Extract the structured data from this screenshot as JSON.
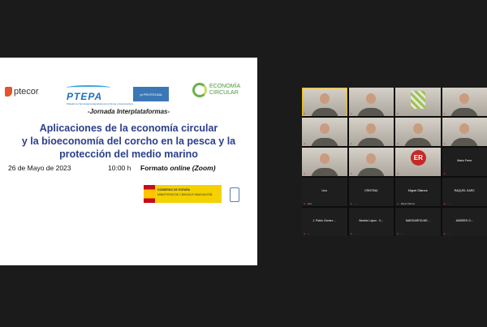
{
  "slide": {
    "logos": {
      "ptecor": "ptecor",
      "ptepa": "PTEPA",
      "ptepa_sub": "Plataforma Tecnológica Española de la Pesca y la Acuicultura",
      "protecma": "pt PROTECMA",
      "ec_line1": "ECONOMÍA",
      "ec_line2": "CIRCULAR"
    },
    "event_label": "-Jornada Interplataformas-",
    "title_lines": [
      "Aplicaciones de la economía circular",
      "y la bioeconomía del corcho en la pesca y la",
      "protección del medio marino"
    ],
    "date": "26 de Mayo de 2023",
    "time": "10:00 h",
    "format_prefix": "Formato ",
    "format_mode": "online (Zoom)",
    "gov_line1": "GOBIERNO DE ESPAÑA",
    "gov_line2": "MINISTERIO DE CIENCIA E INNOVACIÓN"
  },
  "gallery": {
    "tiles": [
      {
        "kind": "video",
        "speaking": true,
        "label": ""
      },
      {
        "kind": "video",
        "label": "..."
      },
      {
        "kind": "pattern",
        "label": "..."
      },
      {
        "kind": "video",
        "label": "..."
      },
      {
        "kind": "video",
        "label": "..."
      },
      {
        "kind": "video",
        "label": "..."
      },
      {
        "kind": "video",
        "label": "..."
      },
      {
        "kind": "video",
        "label": "..."
      },
      {
        "kind": "video",
        "label": "..."
      },
      {
        "kind": "video",
        "label": "..."
      },
      {
        "kind": "logo-er",
        "logo_text": "ER",
        "label": "..."
      },
      {
        "kind": "name",
        "name": "Mario Ferre",
        "label": ""
      },
      {
        "kind": "name",
        "name": "Lino",
        "label": "Lino"
      },
      {
        "kind": "name",
        "name": "CRISTINA",
        "label": "..."
      },
      {
        "kind": "name",
        "name": "Miguel Gilarora",
        "label": "Miguel Gilarora"
      },
      {
        "kind": "name",
        "name": "RAQUEL GARC",
        "label": "..."
      },
      {
        "kind": "name",
        "name": "J. Pablo Gómez ...",
        "label": "..."
      },
      {
        "kind": "name",
        "name": "Beatriz López - V...",
        "label": "..."
      },
      {
        "kind": "name",
        "name": "MARGARITA ME...",
        "label": "..."
      },
      {
        "kind": "name",
        "name": "ANDRES G...",
        "label": "..."
      }
    ]
  },
  "colors": {
    "title": "#2b3f8c",
    "speaking_border": "#f2c200",
    "muted_mic": "#e53935"
  }
}
